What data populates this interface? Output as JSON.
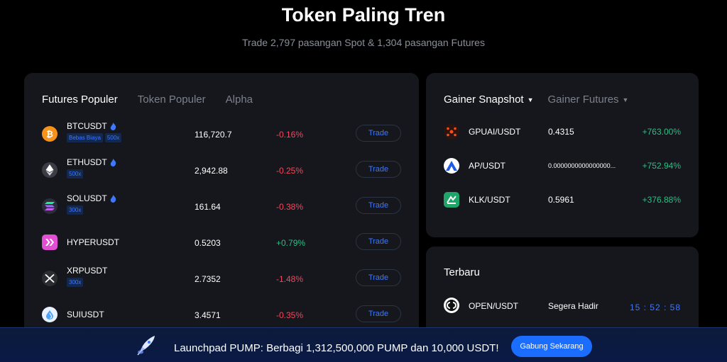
{
  "header": {
    "title": "Token Paling Tren",
    "subtitle": "Trade 2,797 pasangan Spot & 1,304 pasangan Futures"
  },
  "market": {
    "tabs": [
      "Futures Populer",
      "Token Populer",
      "Alpha"
    ],
    "active_tab": "Futures Populer",
    "trade_label": "Trade",
    "rows": [
      {
        "symbol": "BTCUSDT",
        "hot": true,
        "tags": [
          "Bebas Biaya",
          "500x"
        ],
        "price": "116,720.7",
        "change": "-0.16%",
        "icon": "bitcoin-icon",
        "color": "#f7931a"
      },
      {
        "symbol": "ETHUSDT",
        "hot": true,
        "tags": [
          "500x"
        ],
        "price": "2,942.88",
        "change": "-0.25%",
        "icon": "ethereum-icon",
        "color": "#3a3d45"
      },
      {
        "symbol": "SOLUSDT",
        "hot": true,
        "tags": [
          "300x"
        ],
        "price": "161.64",
        "change": "-0.38%",
        "icon": "solana-icon",
        "color": "#2b2d3a"
      },
      {
        "symbol": "HYPERUSDT",
        "hot": false,
        "tags": [],
        "price": "0.5203",
        "change": "+0.79%",
        "icon": "hyperlane-icon",
        "color": "#e34fd3"
      },
      {
        "symbol": "XRPUSDT",
        "hot": false,
        "tags": [
          "300x"
        ],
        "price": "2.7352",
        "change": "-1.48%",
        "icon": "xrp-icon",
        "color": "#2b2d33"
      },
      {
        "symbol": "SUIUSDT",
        "hot": false,
        "tags": [],
        "price": "3.4571",
        "change": "-0.35%",
        "icon": "sui-icon",
        "color": "#e8f1ff"
      }
    ]
  },
  "gainer": {
    "tabs": [
      "Gainer Snapshot",
      "Gainer Futures"
    ],
    "active_tab": "Gainer Snapshot",
    "rows": [
      {
        "symbol": "GPUAI/USDT",
        "price": "0.4315",
        "change": "+763.00%",
        "icon": "gpuai-icon",
        "color": "#2a1510"
      },
      {
        "symbol": "AP/USDT",
        "price": "0.0000000000000000...",
        "change": "+752.94%",
        "icon": "ap-icon",
        "color": "#ffffff"
      },
      {
        "symbol": "KLK/USDT",
        "price": "0.5961",
        "change": "+376.88%",
        "icon": "klk-icon",
        "color": "#1fa56a"
      }
    ]
  },
  "newest": {
    "title": "Terbaru",
    "rows": [
      {
        "symbol": "OPEN/USDT",
        "status": "Segera Hadir",
        "timer": "15 : 52 : 58",
        "icon": "openledger-icon"
      }
    ]
  },
  "banner": {
    "text": "Launchpad PUMP: Berbagi 1,312,500,000 PUMP dan 10,000  USDT!",
    "button": "Gabung Sekarang",
    "icon": "rocket-icon"
  },
  "colors": {
    "up": "#2ebd85",
    "down": "#f6465d",
    "accent": "#3d78ff",
    "button": "#1a6dff",
    "panel": "#15171c"
  }
}
